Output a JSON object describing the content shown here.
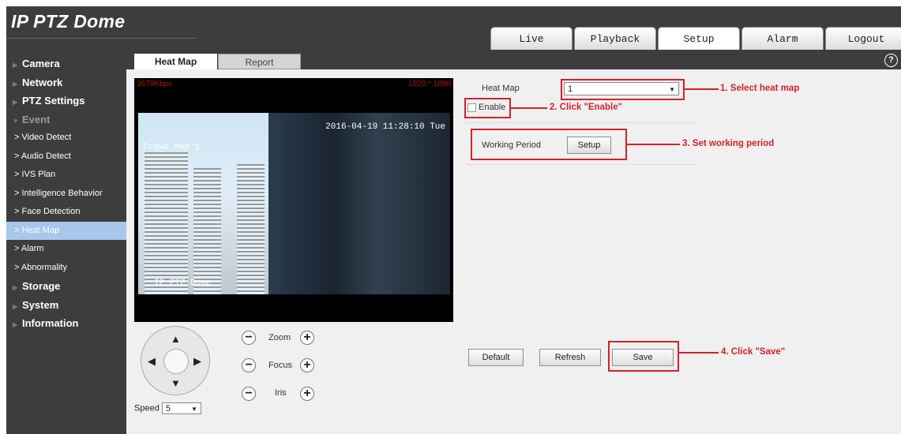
{
  "app": {
    "title": "IP PTZ Dome"
  },
  "nav_tabs": [
    {
      "label": "Live"
    },
    {
      "label": "Playback"
    },
    {
      "label": "Setup",
      "active": true
    },
    {
      "label": "Alarm"
    },
    {
      "label": "Logout"
    }
  ],
  "sidebar": {
    "items": [
      {
        "label": "Camera"
      },
      {
        "label": "Network"
      },
      {
        "label": "PTZ Settings"
      },
      {
        "label": "Event"
      },
      {
        "label": "Video Detect"
      },
      {
        "label": "Audio Detect"
      },
      {
        "label": "IVS Plan"
      },
      {
        "label": "Intelligence Behavior"
      },
      {
        "label": "Face Detection"
      },
      {
        "label": "Heat Map",
        "selected": true
      },
      {
        "label": "Alarm"
      },
      {
        "label": "Abnormality"
      },
      {
        "label": "Storage"
      },
      {
        "label": "System"
      },
      {
        "label": "Information"
      }
    ]
  },
  "subtabs": {
    "heatmap": "Heat Map",
    "report": "Report"
  },
  "help_icon": "?",
  "video": {
    "bitrate": "3679Kbps",
    "resolution": "1920 * 1080",
    "timestamp": "2016-04-19 11:28:10 Tue",
    "overlay_top": "Crowd Map 1",
    "overlay_bottom": "IP PTZ Dome"
  },
  "ptz": {
    "speed_label": "Speed",
    "speed_value": "5",
    "zoom_label": "Zoom",
    "focus_label": "Focus",
    "iris_label": "Iris",
    "minus": "−",
    "plus": "+",
    "up": "▲",
    "down": "▼",
    "left": "◀",
    "right": "▶",
    "caret": "▼"
  },
  "form": {
    "heatmap_label": "Heat Map",
    "heatmap_value": "1",
    "enable_label": "Enable",
    "working_period_label": "Working Period",
    "setup_button": "Setup",
    "default_button": "Default",
    "refresh_button": "Refresh",
    "save_button": "Save"
  },
  "annotations": {
    "a1": "1. Select heat map",
    "a2": "2. Click \"Enable\"",
    "a3": "3. Set working period",
    "a4": "4. Click \"Save\""
  },
  "colors": {
    "annotation": "#d6202a",
    "header_bg": "#3d3d3d",
    "sidebar_selected": "#a6c8ec"
  }
}
